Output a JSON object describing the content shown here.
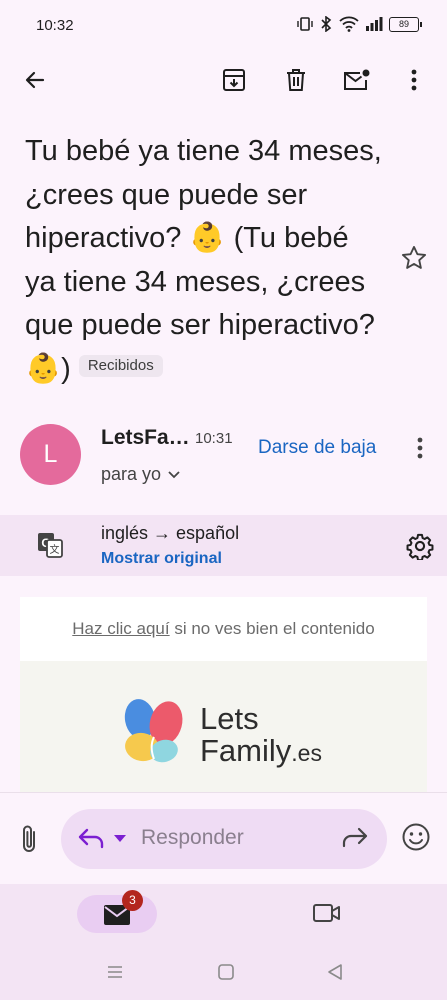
{
  "status_bar": {
    "time": "10:32",
    "battery": "89"
  },
  "toolbar": {
    "back": "back-arrow-icon",
    "archive": "archive-icon",
    "delete": "trash-icon",
    "mark_unread": "mark-unread-icon",
    "more": "more-vert-icon"
  },
  "email": {
    "subject": "Tu bebé ya tiene 34 meses, ¿crees que puede ser hiperactivo? 👶 (Tu bebé ya tiene 34 meses, ¿crees que puede ser hiperactivo? 👶)",
    "label": "Recibidos",
    "sender": {
      "avatar_letter": "L",
      "avatar_color": "#e46a9c",
      "name": "LetsFa…",
      "time": "10:31",
      "to": "para yo",
      "unsubscribe": "Darse de baja"
    }
  },
  "translation": {
    "languages": "inglés → español",
    "show_original": "Mostrar original"
  },
  "body": {
    "notice_link": "Haz clic aquí",
    "notice_text": " si no ves bien el contenido",
    "logo_line1": "Lets",
    "logo_line2": "Family",
    "logo_suffix": ".es"
  },
  "reply": {
    "placeholder": "Responder"
  },
  "bottom_nav": {
    "mail_badge": "3"
  },
  "colors": {
    "accent_blue": "#1a66c2",
    "reply_purple": "#7b1fd1",
    "badge_red": "#b3261e"
  }
}
